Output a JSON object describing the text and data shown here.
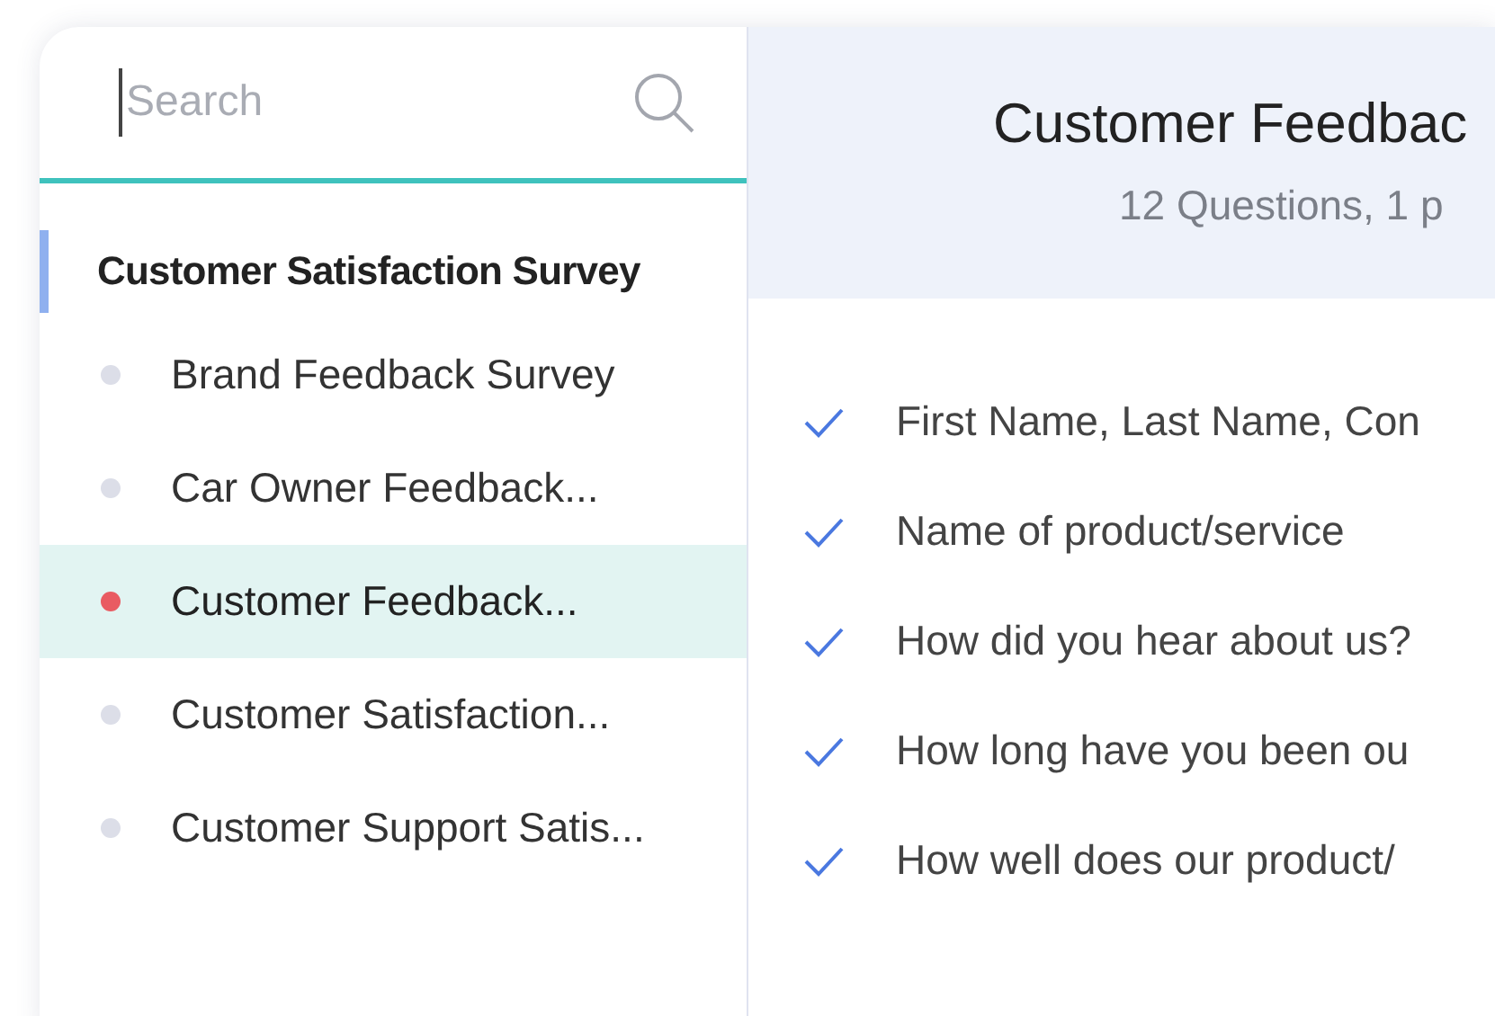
{
  "search": {
    "placeholder": "Search"
  },
  "sidebar": {
    "group_title": "Customer Satisfaction Survey",
    "items": [
      {
        "label": "Brand Feedback Survey",
        "selected": false
      },
      {
        "label": "Car Owner Feedback...",
        "selected": false
      },
      {
        "label": "Customer Feedback...",
        "selected": true
      },
      {
        "label": "Customer Satisfaction...",
        "selected": false
      },
      {
        "label": "Customer Support  Satis...",
        "selected": false
      }
    ]
  },
  "survey": {
    "title": "Customer Feedbac",
    "subtitle": "12 Questions, 1 p",
    "questions": [
      {
        "text": "First Name, Last Name, Con",
        "checked": true
      },
      {
        "text": "Name of product/service",
        "checked": true
      },
      {
        "text": "How did you hear about us?",
        "checked": true
      },
      {
        "text": "How long have you been ou",
        "checked": true
      },
      {
        "text": "How well does our product/",
        "checked": true
      }
    ]
  }
}
